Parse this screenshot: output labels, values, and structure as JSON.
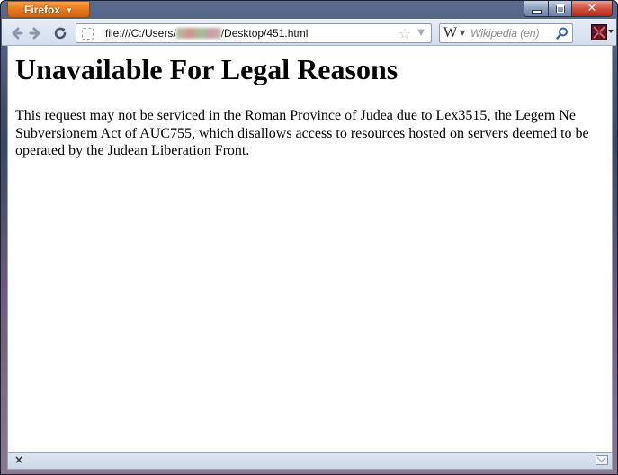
{
  "browser": {
    "menu_button_label": "Firefox",
    "url_prefix": "file:///C:/Users/",
    "url_suffix": "/Desktop/451.html",
    "search_placeholder": "Wikipedia (en)",
    "search_engine_icon": "W",
    "colors": {
      "menu_button": "#e5761a",
      "close_button": "#d0503a",
      "toolbar": "#d4deee"
    },
    "icons": {
      "back": "back-arrow-icon",
      "forward": "forward-arrow-icon",
      "reload": "reload-icon",
      "bookmark": "star-icon",
      "search": "magnifier-icon",
      "status_close": "close-icon",
      "status_mail": "mail-icon"
    }
  },
  "page": {
    "title": "Unavailable For Legal Reasons",
    "body": "This request may not be serviced in the Roman Province of Judea due to Lex3515, the Legem Ne Subversionem Act of AUC755, which disallows access to resources hosted on servers deemed to be operated by the Judean Liberation Front."
  },
  "statusbar": {
    "close_symbol": "×"
  }
}
